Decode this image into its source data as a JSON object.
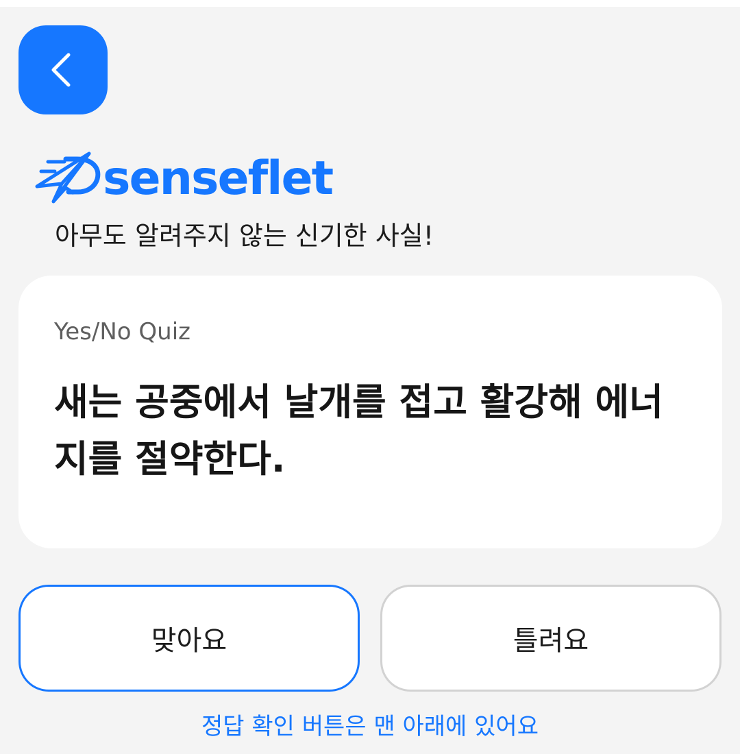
{
  "header": {
    "back_icon": "chevron-left-icon"
  },
  "brand": {
    "logo_icon": "paper-plane-logo-icon",
    "name": "senseflet"
  },
  "tagline": "아무도 알려주지 않는 신기한 사실!",
  "quiz": {
    "type_label": "Yes/No Quiz",
    "question": "새는 공중에서 날개를 접고 활강해 에너지를 절약한다."
  },
  "answers": {
    "yes_label": "맞아요",
    "no_label": "틀려요"
  },
  "hint": "정답 확인 버튼은 맨 아래에 있어요",
  "colors": {
    "accent": "#1677ff",
    "background": "#f4f4f4",
    "card": "#ffffff",
    "neutral_border": "#d2d2d2"
  }
}
